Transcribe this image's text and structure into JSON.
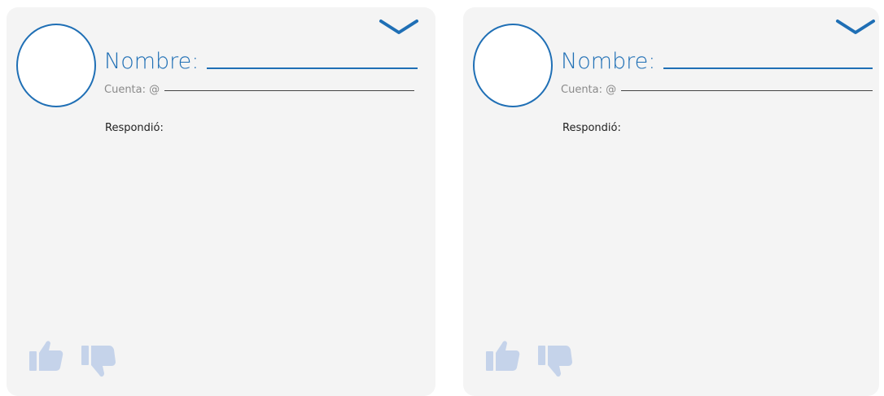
{
  "cards": [
    {
      "name_label": "Nombre:",
      "account_label": "Cuenta: @",
      "replied_label": "Respondió:"
    },
    {
      "name_label": "Nombre:",
      "account_label": "Cuenta: @",
      "replied_label": "Respondió:"
    }
  ],
  "colors": {
    "accent": "#1f6fb5",
    "card_bg": "#f4f4f4",
    "thumb": "#c5d3ea"
  },
  "icons": [
    "chevron-down-icon",
    "thumbs-up-icon",
    "thumbs-down-icon"
  ]
}
